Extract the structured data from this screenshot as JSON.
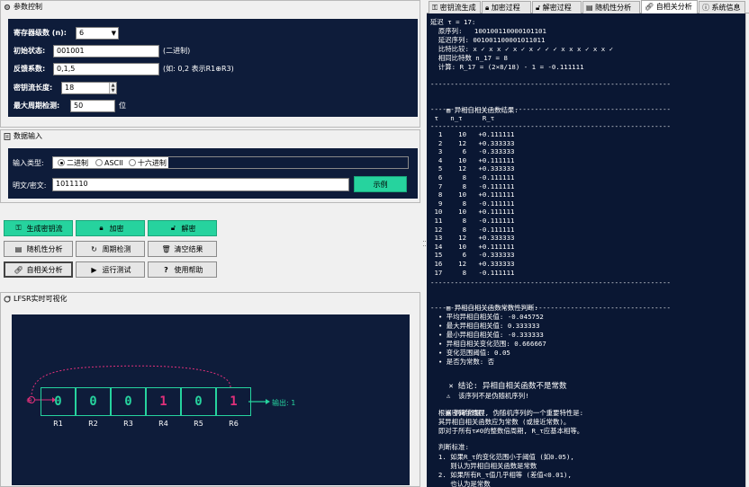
{
  "params": {
    "title": "参数控制",
    "degree_label": "寄存器级数 (n):",
    "degree_value": "6",
    "init_label": "初始状态:",
    "init_value": "001001",
    "init_hint": "(二进制)",
    "feedback_label": "反馈系数:",
    "feedback_value": "0,1,5",
    "feedback_hint": "(如: 0,2 表示R1⊕R3)",
    "keylen_label": "密钥流长度:",
    "keylen_value": "18",
    "maxperiod_label": "最大周期检测:",
    "maxperiod_value": "50",
    "maxperiod_unit": "位"
  },
  "input": {
    "title": "数据输入",
    "type_label": "输入类型:",
    "options": [
      "二进制",
      "ASCII",
      "十六进制"
    ],
    "selected": "二进制",
    "text_label": "明文/密文:",
    "text_value": "1011110",
    "example_button": "示例"
  },
  "buttons": {
    "generate": "生成密钥流",
    "encrypt": "加密",
    "decrypt": "解密",
    "randomness": "随机性分析",
    "period": "周期检测",
    "clear": "清空结果",
    "autocorr": "自相关分析",
    "run_test": "运行测试",
    "help": "使用帮助"
  },
  "viz": {
    "title": "LFSR实时可视化",
    "cells": [
      "0",
      "0",
      "0",
      "1",
      "0",
      "1"
    ],
    "labels": [
      "R1",
      "R2",
      "R3",
      "R4",
      "R5",
      "R6"
    ],
    "output_label": "输出: 1",
    "xor_symbol": "⊕"
  },
  "tabs": [
    "密钥流生成",
    "加密过程",
    "解密过程",
    "随机性分析",
    "自相关分析",
    "系统信息"
  ],
  "active_tab": "自相关分析",
  "console": {
    "header": [
      "延迟 τ = 17:",
      "  原序列:   100100110000101101",
      "  延迟序列: 001001100001011011",
      "  比特比较: x ✓ x x ✓ x ✓ x ✓ ✓ ✓ x x x ✓ x x ✓",
      "  相同比特数 n_17 = 8",
      "  计算: R_17 = (2×8/18) - 1 = -0.111111"
    ],
    "divider": "------------------------------------------------------------",
    "results_title": "异相自相关函数结果:",
    "table_header": " τ   n_τ     R_τ",
    "table_rows": [
      [
        " 1",
        "10",
        "+0.111111"
      ],
      [
        " 2",
        "12",
        "+0.333333"
      ],
      [
        " 3",
        " 6",
        "-0.333333"
      ],
      [
        " 4",
        "10",
        "+0.111111"
      ],
      [
        " 5",
        "12",
        "+0.333333"
      ],
      [
        " 6",
        " 8",
        "-0.111111"
      ],
      [
        " 7",
        " 8",
        "-0.111111"
      ],
      [
        " 8",
        "10",
        "+0.111111"
      ],
      [
        " 9",
        " 8",
        "-0.111111"
      ],
      [
        "10",
        "10",
        "+0.111111"
      ],
      [
        "11",
        " 8",
        "-0.111111"
      ],
      [
        "12",
        " 8",
        "-0.111111"
      ],
      [
        "13",
        "12",
        "+0.333333"
      ],
      [
        "14",
        "10",
        "+0.111111"
      ],
      [
        "15",
        " 6",
        "-0.333333"
      ],
      [
        "16",
        "12",
        "+0.333333"
      ],
      [
        "17",
        " 8",
        "-0.111111"
      ]
    ],
    "analysis_title": "异相自相关函数常数性判断:",
    "analysis_lines": [
      "  • 平均异相自相关值: -0.045752",
      "  • 最大异相自相关值: 0.333333",
      "  • 最小异相自相关值: -0.333333",
      "  • 异相自相关变化范围: 0.666667",
      "  • 变化范围阈值: 0.05",
      "  • 是否为常数: 否"
    ],
    "conclusion": "结论: 异相自相关函数不是常数",
    "warning": "该序列不是伪随机序列!",
    "basis_title": "判断依据:",
    "basis_lines": [
      "  根据密码学原理, 伪随机序列的一个重要特性是:",
      "  其异相自相关函数应为常数 (或接近常数)。",
      "  即对于所有τ≠0的整数倍周期, R_τ应基本相等。",
      "",
      "  判断标准:",
      "  1. 如果R_τ的变化范围小于阈值 (如0.05),",
      "     则认为异相自相关函数是常数",
      "  2. 如果所有R_τ值几乎相等 (差值<0.01),",
      "     也认为是常数"
    ]
  },
  "colors": {
    "navy": "#0e1c3a",
    "accent_green": "#26d39e",
    "feedback_pink": "#e0307a",
    "console_bg": "#0a1733"
  }
}
